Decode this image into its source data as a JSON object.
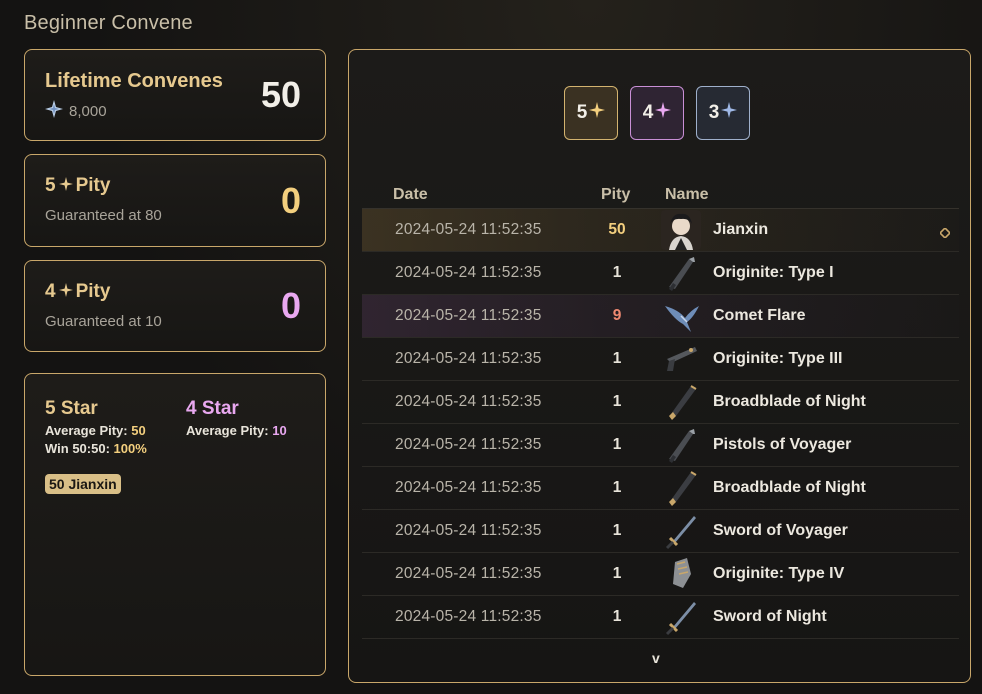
{
  "title": "Beginner Convene",
  "lifetime": {
    "label": "Lifetime Convenes",
    "currency_icon": "astrite-icon",
    "currency_value": "8,000",
    "count": "50"
  },
  "pity5": {
    "star": "5",
    "label": "Pity",
    "sub": "Guaranteed at 80",
    "value": "0"
  },
  "pity4": {
    "star": "4",
    "label": "Pity",
    "sub": "Guaranteed at 10",
    "value": "0"
  },
  "stats": {
    "five": {
      "head": "5 Star",
      "avg_label": "Average Pity:",
      "avg_value": "50",
      "win_label": "Win 50:50:",
      "win_value": "100%"
    },
    "four": {
      "head": "4 Star",
      "avg_label": "Average Pity:",
      "avg_value": "10"
    },
    "tag": "50 Jianxin"
  },
  "filters": [
    {
      "label": "5",
      "color": "#f3cf7e"
    },
    {
      "label": "4",
      "color": "#e9a8f0"
    },
    {
      "label": "3",
      "color": "#9fb8e6"
    }
  ],
  "table": {
    "headers": {
      "date": "Date",
      "pity": "Pity",
      "name": "Name"
    },
    "rows": [
      {
        "date": "2024-05-24 11:52:35",
        "pity": "50",
        "name": "Jianxin",
        "rarity": 5,
        "icon": "character-avatar-icon"
      },
      {
        "date": "2024-05-24 11:52:35",
        "pity": "1",
        "name": "Originite: Type I",
        "rarity": 3,
        "icon": "pistol-weapon-icon"
      },
      {
        "date": "2024-05-24 11:52:35",
        "pity": "9",
        "name": "Comet Flare",
        "rarity": 4,
        "icon": "bird-weapon-icon"
      },
      {
        "date": "2024-05-24 11:52:35",
        "pity": "1",
        "name": "Originite: Type III",
        "rarity": 3,
        "icon": "gun-weapon-icon"
      },
      {
        "date": "2024-05-24 11:52:35",
        "pity": "1",
        "name": "Broadblade of Night",
        "rarity": 3,
        "icon": "broadblade-weapon-icon"
      },
      {
        "date": "2024-05-24 11:52:35",
        "pity": "1",
        "name": "Pistols of Voyager",
        "rarity": 3,
        "icon": "pistol-weapon-icon"
      },
      {
        "date": "2024-05-24 11:52:35",
        "pity": "1",
        "name": "Broadblade of Night",
        "rarity": 3,
        "icon": "broadblade-weapon-icon"
      },
      {
        "date": "2024-05-24 11:52:35",
        "pity": "1",
        "name": "Sword of Voyager",
        "rarity": 3,
        "icon": "sword-weapon-icon"
      },
      {
        "date": "2024-05-24 11:52:35",
        "pity": "1",
        "name": "Originite: Type IV",
        "rarity": 3,
        "icon": "gauntlet-weapon-icon"
      },
      {
        "date": "2024-05-24 11:52:35",
        "pity": "1",
        "name": "Sword of Night",
        "rarity": 3,
        "icon": "sword-weapon-icon"
      }
    ]
  },
  "scroll_more": "v"
}
